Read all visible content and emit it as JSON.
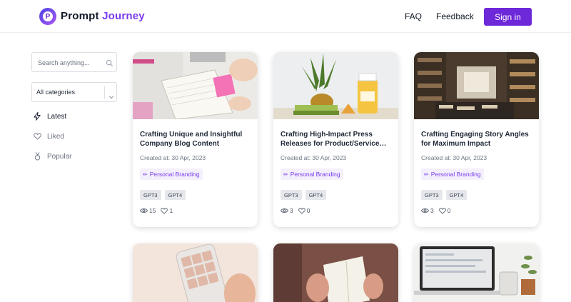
{
  "header": {
    "logo_letter": "P",
    "brand_part1": "Prompt",
    "brand_part2": "Journey",
    "faq": "FAQ",
    "feedback": "Feedback",
    "signin": "Sign in",
    "accent": "#6d28d9"
  },
  "sidebar": {
    "search_placeholder": "Search anything...",
    "category_value": "All categories",
    "items": [
      {
        "label": "Latest",
        "icon": "bolt-icon"
      },
      {
        "label": "Liked",
        "icon": "heart-icon"
      },
      {
        "label": "Popular",
        "icon": "medal-icon"
      }
    ]
  },
  "cards": [
    {
      "title": "Crafting Unique and Insightful Company Blog Content",
      "created": "Created at: 30 Apr, 2023",
      "category": "Personal Branding",
      "tags": [
        "GPT3",
        "GPT4"
      ],
      "views": "15",
      "likes": "1"
    },
    {
      "title": "Crafting High-Impact Press Releases for Product/Service…",
      "created": "Created at: 30 Apr, 2023",
      "category": "Personal Branding",
      "tags": [
        "GPT3",
        "GPT4"
      ],
      "views": "3",
      "likes": "0"
    },
    {
      "title": "Crafting Engaging Story Angles for Maximum Impact",
      "created": "Created at: 30 Apr, 2023",
      "category": "Personal Branding",
      "tags": [
        "GPT3",
        "GPT4"
      ],
      "views": "3",
      "likes": "0"
    }
  ]
}
